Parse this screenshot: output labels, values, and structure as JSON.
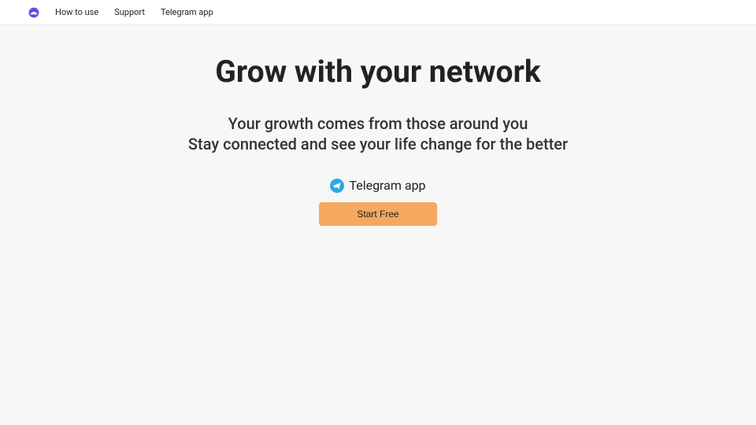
{
  "nav": {
    "links": [
      "How to use",
      "Support",
      "Telegram app"
    ]
  },
  "hero": {
    "title": "Grow with your network",
    "subtitle_line1": "Your growth comes from those around you",
    "subtitle_line2": "Stay connected and see your life change for the better",
    "telegram_label": "Telegram app",
    "cta_label": "Start Free"
  },
  "colors": {
    "cta_bg": "#f4a95e",
    "telegram": "#29a9eb"
  }
}
